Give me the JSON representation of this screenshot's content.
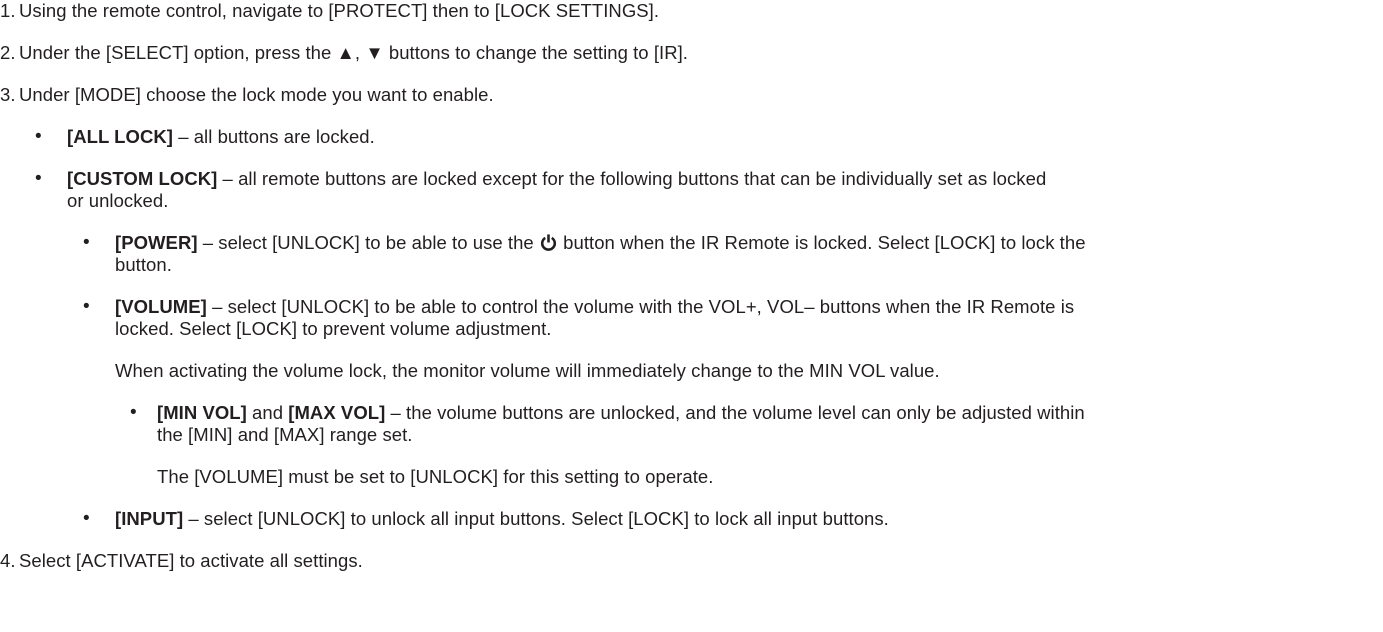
{
  "steps": [
    {
      "number": "1.",
      "text": "Using the remote control, navigate to [PROTECT] then to [LOCK SETTINGS]."
    },
    {
      "number": "2.",
      "text_before": "Under the [SELECT] option, press the ",
      "up_glyph": "▲",
      "comma": ", ",
      "down_glyph": "▼",
      "text_after": " buttons to change the setting to [IR]."
    },
    {
      "number": "3.",
      "text": "Under [MODE] choose the lock mode you want to enable."
    },
    {
      "number": "4.",
      "text": "Select [ACTIVATE] to activate all settings."
    }
  ],
  "bullet_glyph": "•",
  "all_lock": {
    "label": "[ALL LOCK]",
    "text": " – all buttons are locked."
  },
  "custom_lock": {
    "label": "[CUSTOM LOCK]",
    "text_line1": " – all remote buttons are locked except for the following buttons that can be individually set as locked",
    "text_line2": "or unlocked."
  },
  "power": {
    "label": "[POWER]",
    "text_before_icon": " – select [UNLOCK] to be able to use the ",
    "icon": "power-icon",
    "text_after_icon": " button when the IR Remote is locked. Select [LOCK] to lock the",
    "text_line2": "button."
  },
  "volume": {
    "label": "[VOLUME]",
    "text_line1": " – select [UNLOCK] to be able to control the volume with the VOL+, VOL– buttons when the IR Remote is",
    "text_line2": "locked. Select [LOCK] to prevent volume adjustment.",
    "note": "When activating the volume lock, the monitor volume will immediately change to the MIN VOL value."
  },
  "min_max_vol": {
    "label_min": "[MIN VOL]",
    "and": " and ",
    "label_max": "[MAX VOL]",
    "text_line1": " – the volume buttons are unlocked, and the volume level can only be adjusted within",
    "text_line2": "the [MIN] and [MAX] range set.",
    "note": "The [VOLUME] must be set to [UNLOCK] for this setting to operate."
  },
  "input": {
    "label": "[INPUT]",
    "text": " – select [UNLOCK] to unlock all input buttons. Select [LOCK] to lock all input buttons."
  }
}
